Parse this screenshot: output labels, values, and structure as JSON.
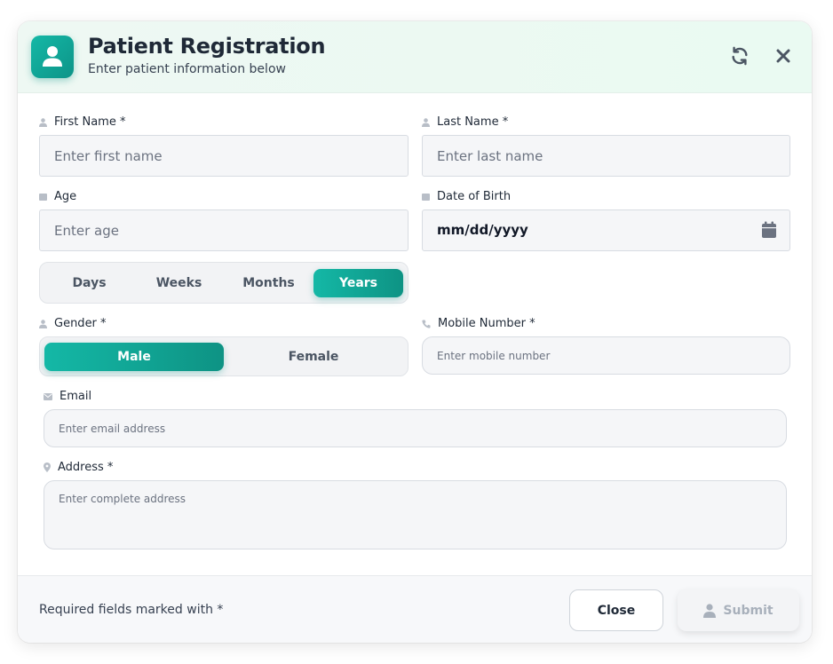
{
  "header": {
    "title": "Patient Registration",
    "subtitle": "Enter patient information below"
  },
  "fields": {
    "first_name": {
      "label": "First Name *",
      "placeholder": "Enter first name"
    },
    "last_name": {
      "label": "Last Name *",
      "placeholder": "Enter last name"
    },
    "age": {
      "label": "Age",
      "placeholder": "Enter age"
    },
    "dob": {
      "label": "Date of Birth",
      "value": "mm/dd/yyyy"
    },
    "gender": {
      "label": "Gender *"
    },
    "mobile": {
      "label": "Mobile Number *",
      "placeholder": "Enter mobile number"
    },
    "email": {
      "label": "Email",
      "placeholder": "Enter email address"
    },
    "address": {
      "label": "Address *",
      "placeholder": "Enter complete address"
    }
  },
  "age_units": {
    "options": [
      "Days",
      "Weeks",
      "Months",
      "Years"
    ],
    "selected": "Years"
  },
  "gender_options": {
    "options": [
      "Male",
      "Female"
    ],
    "selected": "Male"
  },
  "footer": {
    "note": "Required fields marked with *",
    "close_label": "Close",
    "submit_label": "Submit"
  },
  "icons": {
    "avatar": "user-icon",
    "refresh": "refresh-icon",
    "close": "close-icon",
    "calendar": "calendar-icon"
  },
  "colors": {
    "accent": "#14b8a6",
    "accent_dark": "#0d9488",
    "header_bg": "#eef8f3"
  }
}
